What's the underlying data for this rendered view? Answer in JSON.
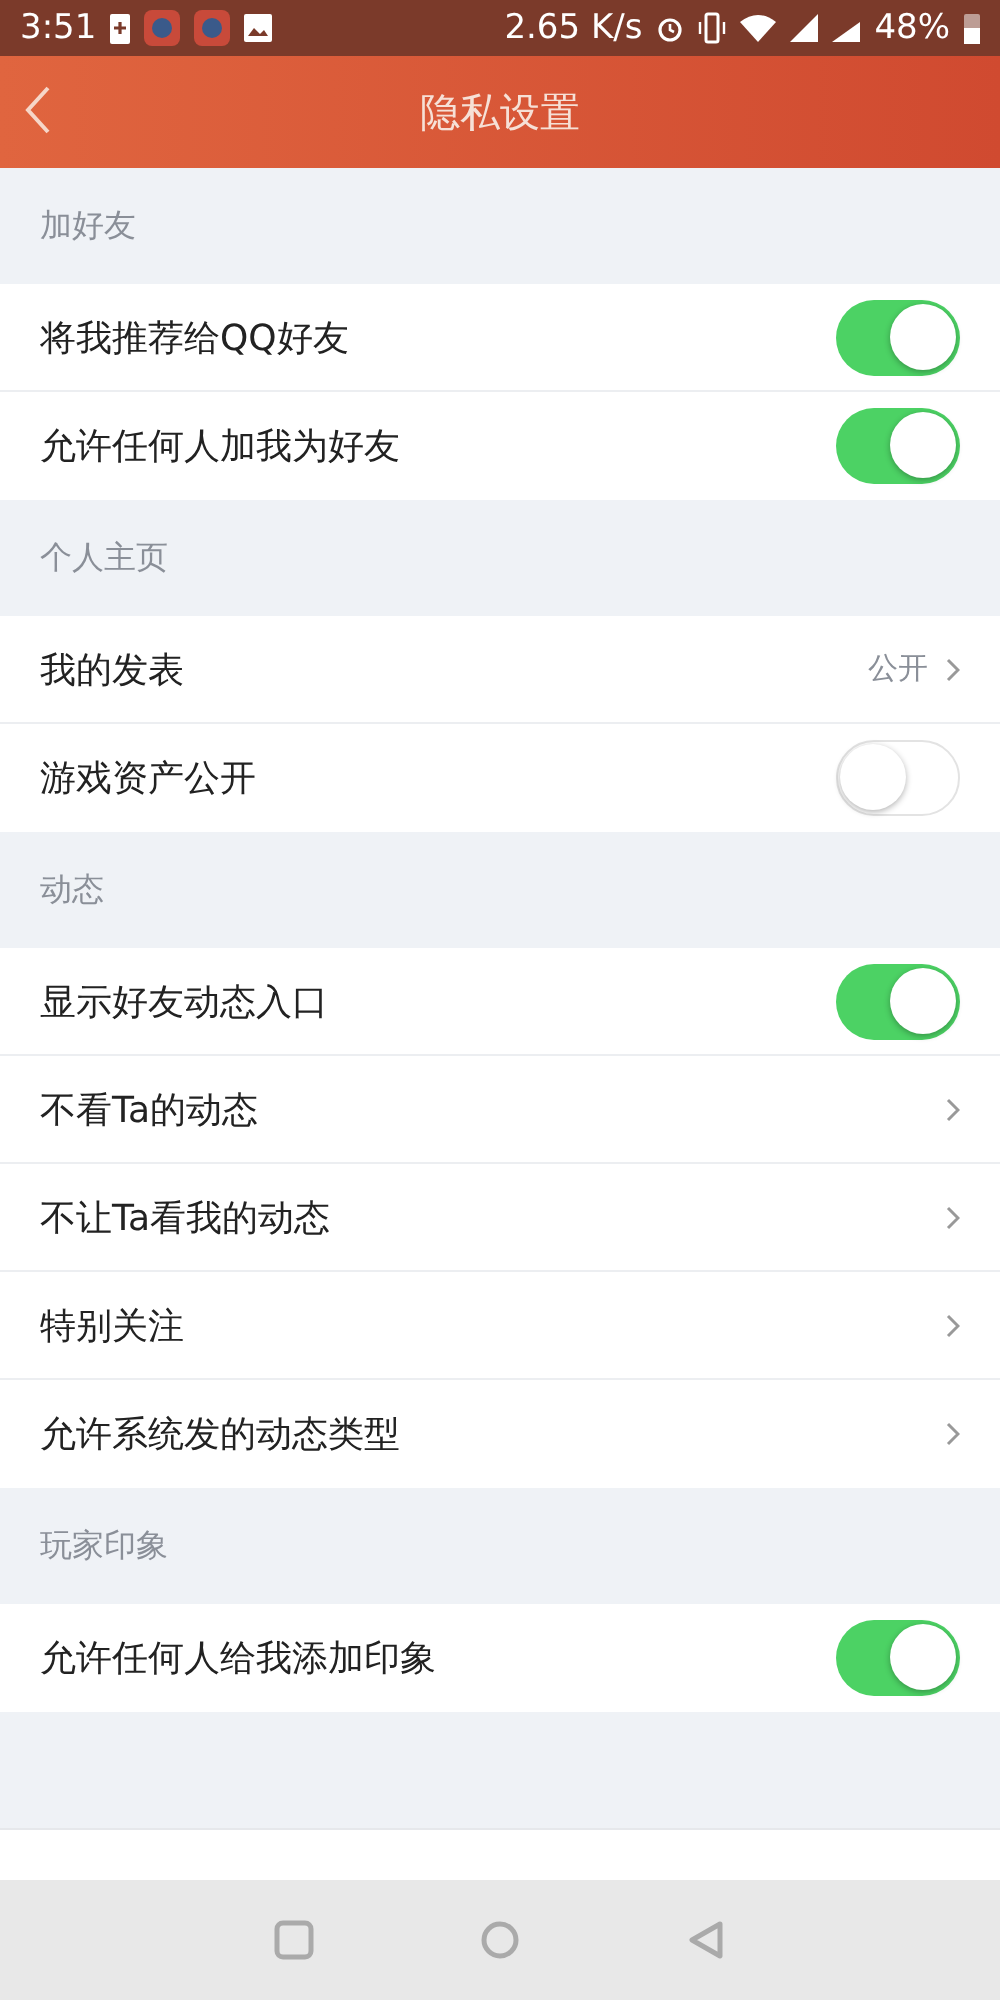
{
  "status_bar": {
    "time": "3:51",
    "speed": "2.65 K/s",
    "battery": "48%"
  },
  "header": {
    "title": "隐私设置"
  },
  "sections": [
    {
      "title": "加好友",
      "items": [
        {
          "kind": "toggle",
          "label": "将我推荐给QQ好友",
          "on": true
        },
        {
          "kind": "toggle",
          "label": "允许任何人加我为好友",
          "on": true
        }
      ]
    },
    {
      "title": "个人主页",
      "items": [
        {
          "kind": "link",
          "label": "我的发表",
          "value": "公开"
        },
        {
          "kind": "toggle",
          "label": "游戏资产公开",
          "on": false
        }
      ]
    },
    {
      "title": "动态",
      "items": [
        {
          "kind": "toggle",
          "label": "显示好友动态入口",
          "on": true
        },
        {
          "kind": "link",
          "label": "不看Ta的动态"
        },
        {
          "kind": "link",
          "label": "不让Ta看我的动态"
        },
        {
          "kind": "link",
          "label": "特别关注"
        },
        {
          "kind": "link",
          "label": "允许系统发的动态类型"
        }
      ]
    },
    {
      "title": "玩家印象",
      "items": [
        {
          "kind": "toggle",
          "label": "允许任何人给我添加印象",
          "on": true
        }
      ]
    }
  ]
}
